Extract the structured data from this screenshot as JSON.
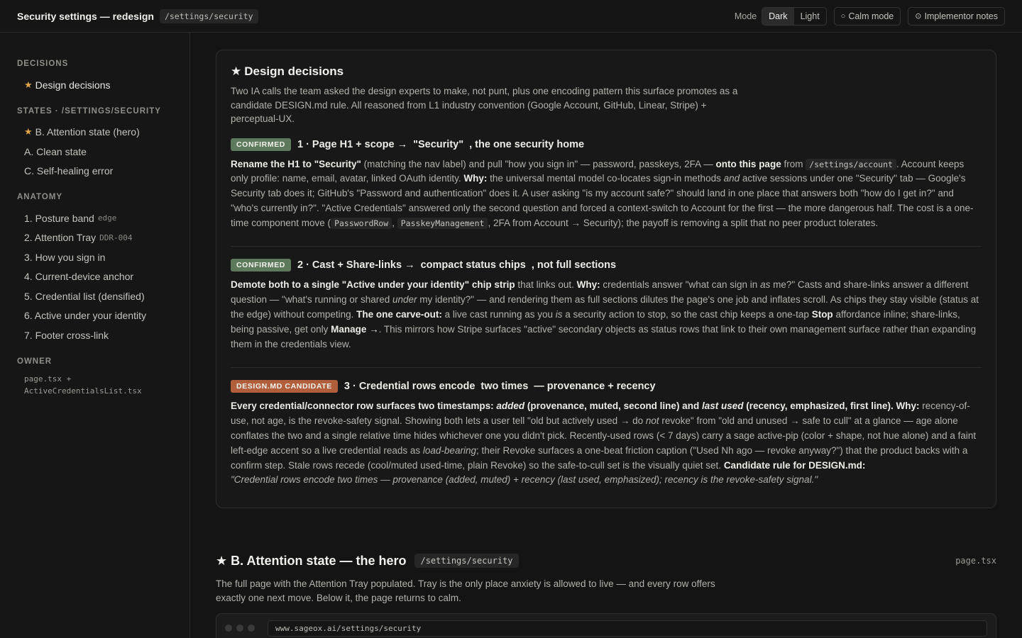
{
  "header": {
    "title": "Security settings — redesign",
    "route": "/settings/security",
    "mode_label": "Mode",
    "mode_options": [
      "Dark",
      "Light"
    ],
    "mode_selected": "Dark",
    "calm_mode_label": "Calm mode",
    "implementor_notes_label": "Implementor notes"
  },
  "sidebar": {
    "groups": [
      {
        "heading": "DECISIONS",
        "items": [
          {
            "label": "Design decisions",
            "starred": true
          }
        ]
      },
      {
        "heading": "STATES · /SETTINGS/SECURITY",
        "items": [
          {
            "label": "B. Attention state (hero)",
            "starred": true
          },
          {
            "label": "A. Clean state"
          },
          {
            "label": "C. Self-healing error"
          }
        ]
      },
      {
        "heading": "ANATOMY",
        "items": [
          {
            "label": "1. Posture band",
            "tag": "edge"
          },
          {
            "label": "2. Attention Tray",
            "tag": "DDR-004"
          },
          {
            "label": "3. How you sign in"
          },
          {
            "label": "4. Current-device anchor"
          },
          {
            "label": "5. Credential list (densified)"
          },
          {
            "label": "6. Active under your identity"
          },
          {
            "label": "7. Footer cross-link"
          }
        ]
      },
      {
        "heading": "OWNER",
        "owner_lines": [
          "page.tsx +",
          "ActiveCredentialsList.tsx"
        ]
      }
    ]
  },
  "decisions_card": {
    "title": "Design decisions",
    "intro": "Two IA calls the team asked the design experts to make, not punt, plus one encoding pattern this surface promotes as a candidate DESIGN.md rule. All reasoned from L1 industry convention (Google Account, GitHub, Linear, Stripe) + perceptual-UX.",
    "d1": {
      "badge": "CONFIRMED",
      "head_a": "1 · Page H1 + scope →",
      "head_b": "\"Security\"",
      "head_c": ", the one security home",
      "s1": "Rename the H1 to \"Security\"",
      "t1": " (matching the nav label) and pull \"how you sign in\" — password, passkeys, 2FA — ",
      "s2": "onto this page",
      "t2": " from ",
      "c1": "/settings/account",
      "t3": ". Account keeps only profile: name, email, avatar, linked OAuth identity. ",
      "s3": "Why:",
      "t4": " the universal mental model co-locates sign-in methods ",
      "i1": "and",
      "t5": " active sessions under one \"Security\" tab — Google's Security tab does it; GitHub's \"Password and authentication\" does it. A user asking \"is my account safe?\" should land in one place that answers both \"how do I get in?\" and \"who's currently in?\". \"Active Credentials\" answered only the second question and forced a context-switch to Account for the first — the more dangerous half. The cost is a one-time component move (",
      "c2": "PasswordRow",
      "t6": ", ",
      "c3": "PasskeyManagement",
      "t7": ", 2FA from Account → Security); the payoff is removing a split that no peer product tolerates."
    },
    "d2": {
      "badge": "CONFIRMED",
      "head_a": "2 · Cast + Share-links →",
      "head_b": "compact status chips",
      "head_c": ", not full sections",
      "s1": "Demote both to a single \"Active under your identity\" chip strip",
      "t1": " that links out. ",
      "s2": "Why:",
      "t2": " credentials answer \"what can sign in ",
      "i1": "as",
      "t3": " me?\" Casts and share-links answer a different question — \"what's running or shared ",
      "i2": "under",
      "t4": " my identity?\" — and rendering them as full sections dilutes the page's one job and inflates scroll. As chips they stay visible (status at the edge) without competing. ",
      "s3": "The one carve-out:",
      "t5": " a live cast running as you ",
      "i3": "is",
      "t6": " a security action to stop, so the cast chip keeps a one-tap ",
      "s4": "Stop",
      "t7": " affordance inline; share-links, being passive, get only ",
      "s5": "Manage →",
      "t8": ". This mirrors how Stripe surfaces \"active\" secondary objects as status rows that link to their own management surface rather than expanding them in the credentials view."
    },
    "d3": {
      "badge": "DESIGN.MD CANDIDATE",
      "head_a": "3 · Credential rows encode",
      "head_b": "two times",
      "head_c": "— provenance + recency",
      "s1": "Every credential/connector row surfaces two timestamps: ",
      "si1": "added",
      "s2": " (provenance, muted, second line) and ",
      "si2": "last used",
      "s3": " (recency, emphasized, first line). Why:",
      "t1": " recency-of-use, not age, is the revoke-safety signal. Showing both lets a user tell \"old but actively used → do ",
      "i1": "not",
      "t2": " revoke\" from \"old and unused → safe to cull\" at a glance — age alone conflates the two and a single relative time hides whichever one you didn't pick. Recently-used rows (< 7 days) carry a sage active-pip (color + shape, not hue alone) and a faint left-edge accent so a live credential reads as ",
      "i2": "load-bearing",
      "t3": "; their Revoke surfaces a one-beat friction caption (\"Used Nh ago — revoke anyway?\") that the product backs with a confirm step. Stale rows recede (cool/muted used-time, plain Revoke) so the safe-to-cull set is the visually quiet set. ",
      "s4": "Candidate rule for DESIGN.md:",
      "quote": "\"Credential rows encode two times — provenance (added, muted) + recency (last used, emphasized); recency is the revoke-safety signal.\""
    }
  },
  "section_b": {
    "title": "B. Attention state — the hero",
    "route": "/settings/security",
    "file": "page.tsx",
    "description": "The full page with the Attention Tray populated. Tray is the only place anxiety is allowed to live — and every row offers exactly one next move. Below it, the page returns to calm.",
    "browser_url": "www.sageox.ai/settings/security"
  },
  "colors": {
    "accent_star": "#e0a64a",
    "badge_confirmed": "#5e7a5c",
    "badge_candidate": "#b05e3b"
  }
}
